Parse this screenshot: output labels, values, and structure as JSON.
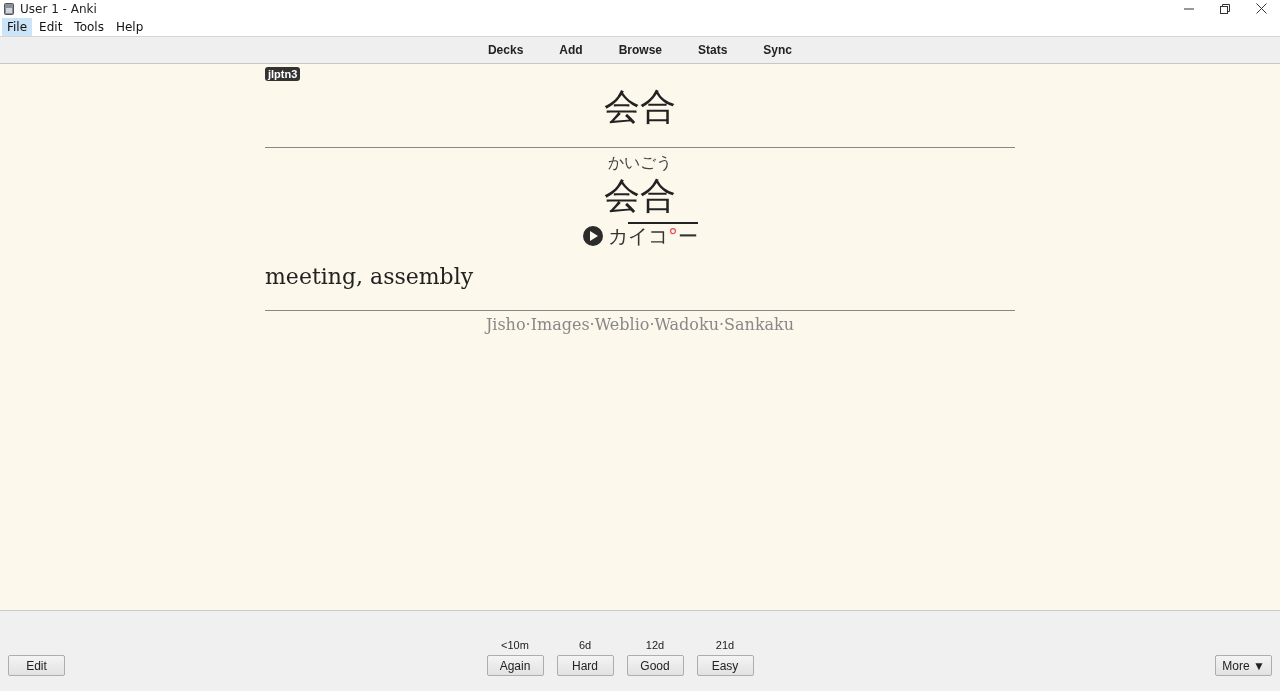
{
  "window": {
    "title": "User 1 - Anki"
  },
  "menu": [
    {
      "label": "File",
      "selected": true
    },
    {
      "label": "Edit",
      "selected": false
    },
    {
      "label": "Tools",
      "selected": false
    },
    {
      "label": "Help",
      "selected": false
    }
  ],
  "toolbar": [
    "Decks",
    "Add",
    "Browse",
    "Stats",
    "Sync"
  ],
  "card": {
    "tag": "jlptn3",
    "front": "会合",
    "reading": "かいごう",
    "expression": "会合",
    "pitch": [
      {
        "text": "カ",
        "overline": false
      },
      {
        "text": "イコ",
        "overline": true
      },
      {
        "text": "°",
        "overline": true,
        "color": "#e8505a"
      },
      {
        "text": "ー",
        "overline": true
      }
    ],
    "meaning": "meeting, assembly",
    "separator": "·",
    "links": [
      "Jisho",
      "Images",
      "Weblio",
      "Wadoku",
      "Sankaku"
    ]
  },
  "bottom": {
    "edit": "Edit",
    "more": "More ▼",
    "answers": [
      {
        "interval": "<10m",
        "label": "Again"
      },
      {
        "interval": "6d",
        "label": "Hard"
      },
      {
        "interval": "12d",
        "label": "Good"
      },
      {
        "interval": "21d",
        "label": "Easy"
      }
    ]
  }
}
